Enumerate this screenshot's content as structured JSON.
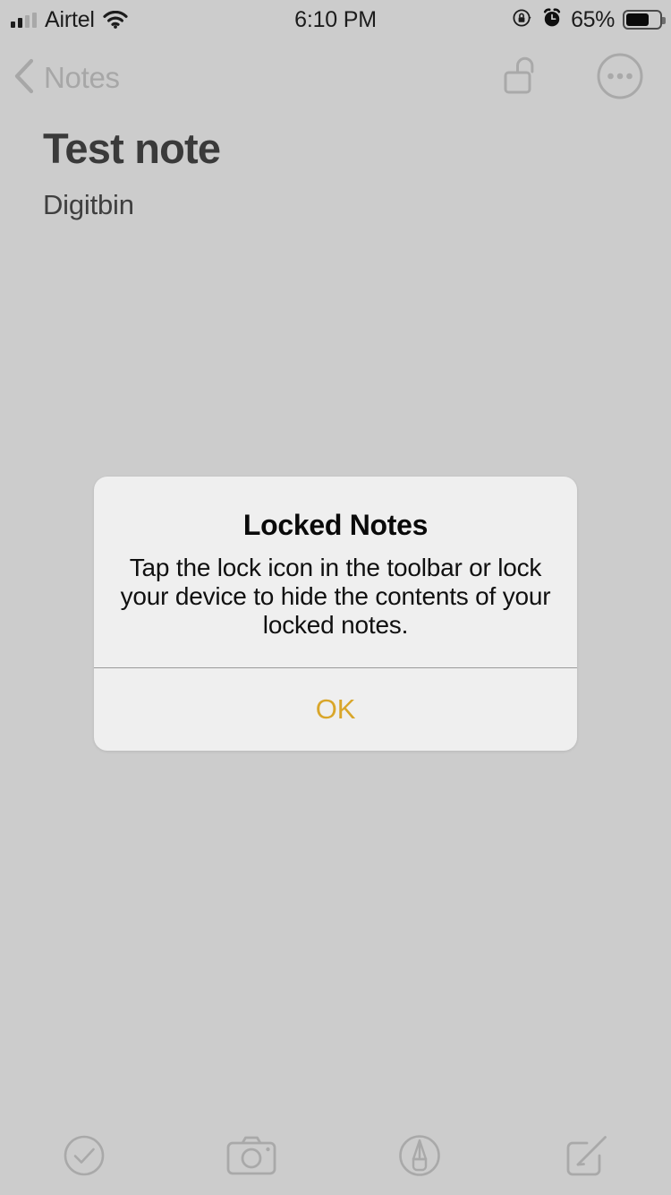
{
  "status_bar": {
    "carrier": "Airtel",
    "signal_icon": "cellular-signal-icon",
    "wifi_icon": "wifi-icon",
    "time": "6:10 PM",
    "rotation_lock_icon": "rotation-lock-icon",
    "alarm_icon": "alarm-clock-icon",
    "battery_percent": "65%",
    "battery_level": 65,
    "battery_icon": "battery-icon"
  },
  "nav_bar": {
    "back_label": "Notes",
    "back_chevron_icon": "chevron-left-icon",
    "lock_icon": "unlocked-padlock-icon",
    "more_icon": "more-circle-icon"
  },
  "note": {
    "title": "Test note",
    "text": "Digitbin"
  },
  "alert": {
    "title": "Locked Notes",
    "message": "Tap the lock icon in the toolbar or lock your device to hide the contents of your locked notes.",
    "ok_label": "OK"
  },
  "toolbar": {
    "checklist_icon": "checklist-circle-icon",
    "camera_icon": "camera-icon",
    "markup_icon": "markup-pen-circle-icon",
    "compose_icon": "compose-icon"
  },
  "colors": {
    "background": "#cccccc",
    "alert_background": "#efefef",
    "accent": "#d9a62a",
    "dimmed_control": "#a9a9a9",
    "text_primary": "#3a3a3a"
  }
}
